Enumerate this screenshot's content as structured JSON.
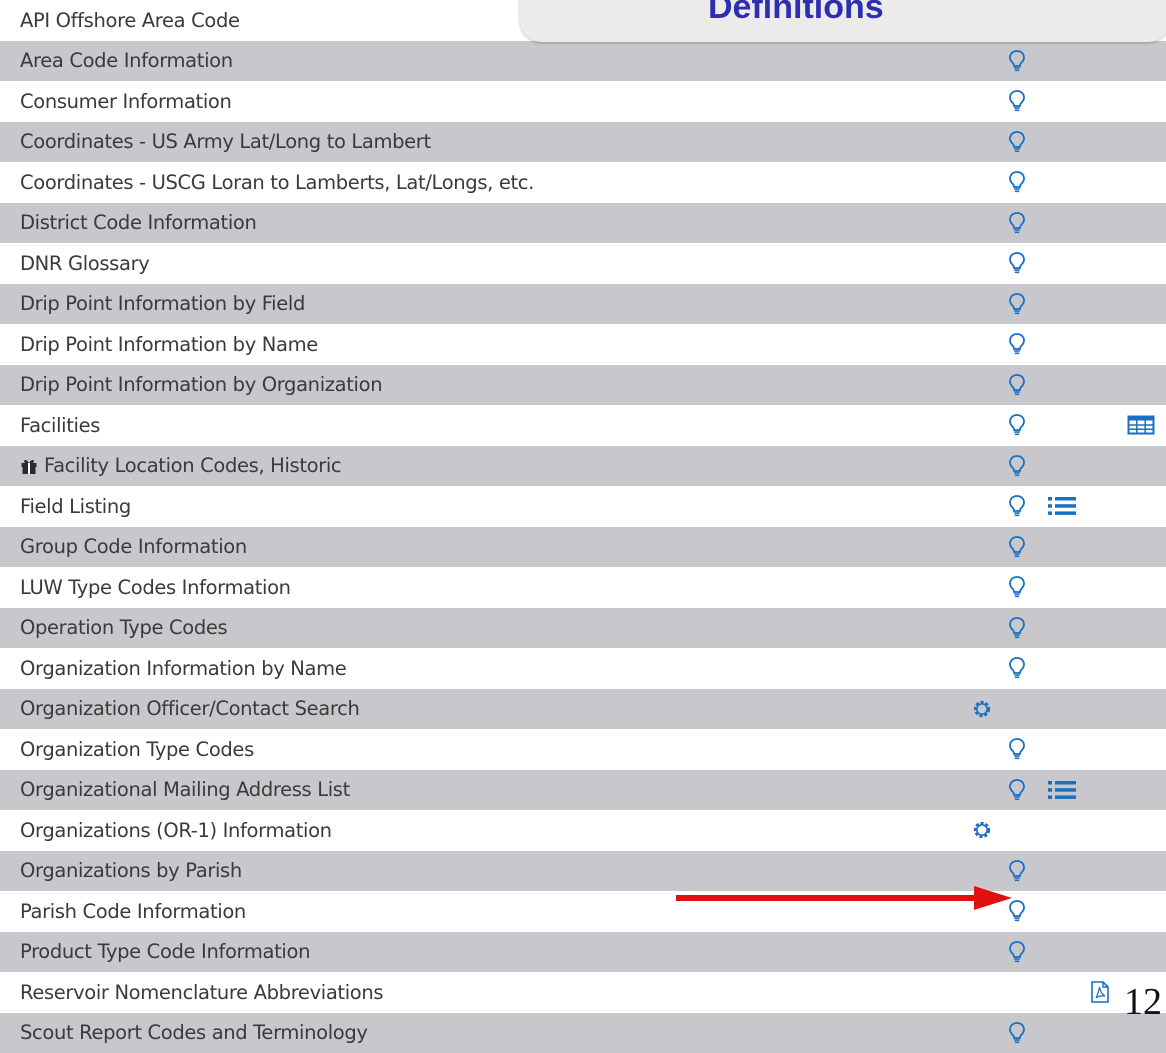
{
  "popup": {
    "title": "Definitions"
  },
  "items": [
    {
      "label": "API Offshore Area Code",
      "icons": []
    },
    {
      "label": "Area Code Information",
      "icons": [
        "bulb-icon"
      ]
    },
    {
      "label": "Consumer Information",
      "icons": [
        "bulb-icon"
      ]
    },
    {
      "label": "Coordinates - US Army Lat/Long to Lambert",
      "icons": [
        "bulb-icon"
      ]
    },
    {
      "label": "Coordinates - USCG Loran to Lamberts, Lat/Longs, etc.",
      "icons": [
        "bulb-icon"
      ]
    },
    {
      "label": "District Code Information",
      "icons": [
        "bulb-icon"
      ]
    },
    {
      "label": "DNR Glossary",
      "icons": [
        "bulb-icon"
      ]
    },
    {
      "label": "Drip Point Information by Field",
      "icons": [
        "bulb-icon"
      ]
    },
    {
      "label": "Drip Point Information by Name",
      "icons": [
        "bulb-icon"
      ]
    },
    {
      "label": "Drip Point Information by Organization",
      "icons": [
        "bulb-icon"
      ]
    },
    {
      "label": "Facilities",
      "icons": [
        "bulb-icon",
        "table-icon"
      ]
    },
    {
      "label": "Facility Location Codes, Historic",
      "icons": [
        "bulb-icon"
      ],
      "prefix_icon": "gift-icon"
    },
    {
      "label": "Field Listing",
      "icons": [
        "bulb-icon",
        "list-icon"
      ]
    },
    {
      "label": "Group Code Information",
      "icons": [
        "bulb-icon"
      ]
    },
    {
      "label": "LUW Type Codes Information",
      "icons": [
        "bulb-icon"
      ]
    },
    {
      "label": "Operation Type Codes",
      "icons": [
        "bulb-icon"
      ]
    },
    {
      "label": "Organization Information by Name",
      "icons": [
        "bulb-icon"
      ]
    },
    {
      "label": "Organization Officer/Contact Search",
      "icons": [
        "gear-icon"
      ]
    },
    {
      "label": "Organization Type Codes",
      "icons": [
        "bulb-icon"
      ]
    },
    {
      "label": "Organizational Mailing Address List",
      "icons": [
        "bulb-icon",
        "list-icon"
      ]
    },
    {
      "label": "Organizations (OR-1) Information",
      "icons": [
        "gear-icon"
      ]
    },
    {
      "label": "Organizations by Parish",
      "icons": [
        "bulb-icon"
      ]
    },
    {
      "label": "Parish Code Information",
      "icons": [
        "bulb-icon"
      ]
    },
    {
      "label": "Product Type Code Information",
      "icons": [
        "bulb-icon"
      ]
    },
    {
      "label": "Reservoir Nomenclature Abbreviations",
      "icons": [
        "pdf-icon"
      ]
    },
    {
      "label": "Scout Report Codes and Terminology",
      "icons": [
        "bulb-icon"
      ]
    }
  ],
  "annotation": {
    "arrow_target": "Parish Code Information",
    "arrow_color": "#e01010"
  },
  "colors": {
    "row_alt": "#c8c8cc",
    "icon_blue": "#1a6fc4",
    "popup_title": "#2d2fb0"
  },
  "page_number": "12"
}
